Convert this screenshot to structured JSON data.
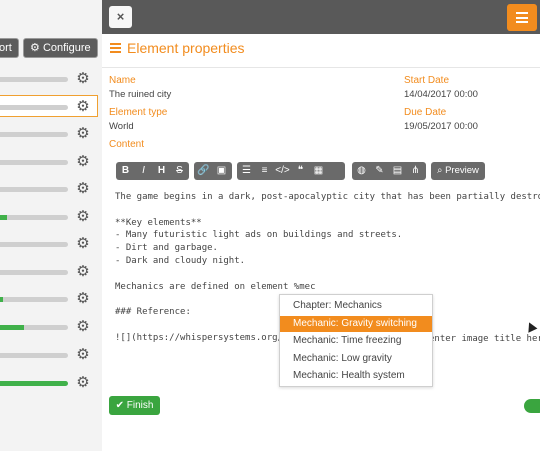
{
  "background": {
    "export_label": "ort",
    "configure_label": "Configure",
    "rows": [
      {
        "progress": 0.0,
        "selected": false
      },
      {
        "progress": 0.0,
        "selected": true
      },
      {
        "progress": 0.0,
        "selected": false
      },
      {
        "progress": 0.0,
        "selected": false
      },
      {
        "progress": 0.0,
        "selected": false
      },
      {
        "progress": 0.1,
        "selected": false
      },
      {
        "progress": 0.0,
        "selected": false
      },
      {
        "progress": 0.0,
        "selected": false
      },
      {
        "progress": 0.05,
        "selected": false
      },
      {
        "progress": 0.35,
        "selected": false
      },
      {
        "progress": 0.0,
        "selected": false
      },
      {
        "progress": 1.0,
        "selected": false
      }
    ],
    "colors": {
      "progress": "#40b14a",
      "track": "#cfcfcf",
      "selected_border": "#f0a030"
    }
  },
  "modal": {
    "close_label": "×",
    "title": "Element properties",
    "name_label": "Name",
    "name_value": "The ruined city",
    "start_label": "Start Date",
    "start_value": "14/04/2017 00:00",
    "type_label": "Element type",
    "type_value": "World",
    "due_label": "Due Date",
    "due_value": "19/05/2017 00:00",
    "content_label": "Content",
    "accent_color": "#f28c1e"
  },
  "toolbar": {
    "bold": "B",
    "italic": "I",
    "heading": "H",
    "strike": "S",
    "preview_label": "Preview"
  },
  "editor": {
    "lines": [
      "The game begins in a dark, post-apocalyptic city that has been partially destroyed by",
      "",
      "**Key elements**",
      "- Many futuristic light ads on buildings and streets.",
      "- Dirt and garbage.",
      "- Dark and cloudy night.",
      "",
      "Mechanics are defined on element %mec",
      "",
      "### Reference:",
      "",
      "![](https://whispersystems.org/bl"
    ],
    "trailing_fragment": "enter image title here"
  },
  "autocomplete": {
    "items": [
      {
        "label": "Chapter: Mechanics"
      },
      {
        "label": "Mechanic: Gravity switching",
        "active": true
      },
      {
        "label": "Mechanic: Time freezing"
      },
      {
        "label": "Mechanic: Low gravity"
      },
      {
        "label": "Mechanic: Health system"
      }
    ]
  },
  "footer": {
    "finish_label": "Finish"
  }
}
